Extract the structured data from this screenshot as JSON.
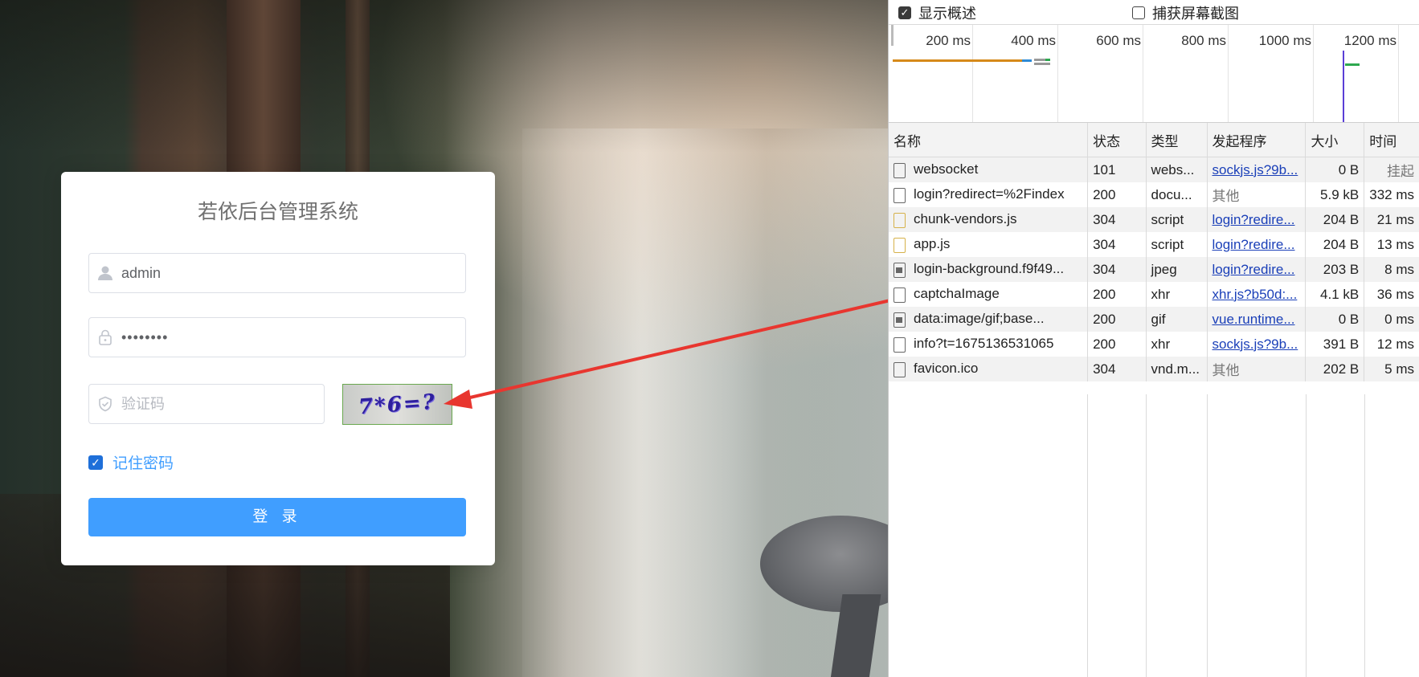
{
  "login": {
    "title": "若依后台管理系统",
    "username_value": "admin",
    "password_value": "••••••••",
    "captcha_placeholder": "验证码",
    "captcha_text": "7*6=?",
    "remember_label": "记住密码",
    "remember_checked": true,
    "login_button": "登 录",
    "accent_color": "#409eff"
  },
  "devtools": {
    "options": [
      {
        "label": "显示概述",
        "checked": true
      },
      {
        "label": "捕获屏幕截图",
        "checked": false
      }
    ],
    "timeline_ticks": [
      "200 ms",
      "400 ms",
      "600 ms",
      "800 ms",
      "1000 ms",
      "1200 ms"
    ],
    "columns": [
      "名称",
      "状态",
      "类型",
      "发起程序",
      "大小",
      "时间"
    ],
    "rows": [
      {
        "name": "websocket",
        "status": "101",
        "type": "webs...",
        "initiator": "sockjs.js?9b...",
        "initiator_link": true,
        "size": "0 B",
        "time": "挂起",
        "icon": "file"
      },
      {
        "name": "login?redirect=%2Findex",
        "status": "200",
        "type": "docu...",
        "initiator": "其他",
        "initiator_link": false,
        "size": "5.9 kB",
        "time": "332 ms",
        "icon": "file"
      },
      {
        "name": "chunk-vendors.js",
        "status": "304",
        "type": "script",
        "initiator": "login?redire...",
        "initiator_link": true,
        "size": "204 B",
        "time": "21 ms",
        "icon": "js"
      },
      {
        "name": "app.js",
        "status": "304",
        "type": "script",
        "initiator": "login?redire...",
        "initiator_link": true,
        "size": "204 B",
        "time": "13 ms",
        "icon": "js"
      },
      {
        "name": "login-background.f9f49...",
        "status": "304",
        "type": "jpeg",
        "initiator": "login?redire...",
        "initiator_link": true,
        "size": "203 B",
        "time": "8 ms",
        "icon": "img"
      },
      {
        "name": "captchaImage",
        "status": "200",
        "type": "xhr",
        "initiator": "xhr.js?b50d:...",
        "initiator_link": true,
        "size": "4.1 kB",
        "time": "36 ms",
        "icon": "file"
      },
      {
        "name": "data:image/gif;base...",
        "status": "200",
        "type": "gif",
        "initiator": "vue.runtime...",
        "initiator_link": true,
        "size": "0 B",
        "time": "0 ms",
        "icon": "img"
      },
      {
        "name": "info?t=1675136531065",
        "status": "200",
        "type": "xhr",
        "initiator": "sockjs.js?9b...",
        "initiator_link": true,
        "size": "391 B",
        "time": "12 ms",
        "icon": "file"
      },
      {
        "name": "favicon.ico",
        "status": "304",
        "type": "vnd.m...",
        "initiator": "其他",
        "initiator_link": false,
        "size": "202 B",
        "time": "5 ms",
        "icon": "file"
      }
    ]
  }
}
